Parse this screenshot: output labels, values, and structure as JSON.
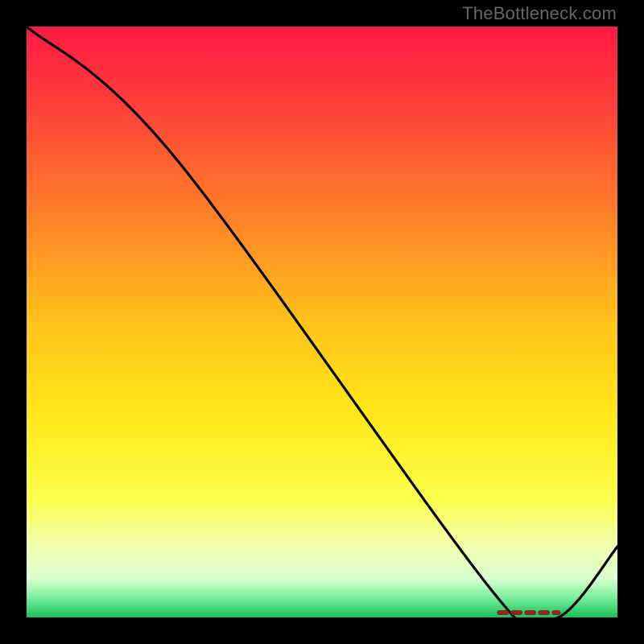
{
  "watermark": "TheBottleneck.com",
  "chart_data": {
    "type": "line",
    "title": "",
    "xlabel": "",
    "ylabel": "",
    "xlim": [
      0,
      100
    ],
    "ylim": [
      0,
      100
    ],
    "x": [
      0,
      25,
      80,
      90,
      100
    ],
    "values": [
      100,
      78,
      3,
      0,
      12
    ],
    "note": "Curve estimated from pixel positions; no axis ticks are rendered in the image.",
    "optimal_band": {
      "x_start": 80,
      "x_end": 90
    },
    "markers": {
      "description": "short dashed maroon stroke near curve minimum",
      "x_start": 80,
      "x_end": 90,
      "y": 0
    },
    "background_gradient_stops": [
      {
        "offset": 0.0,
        "color": "#ff1a44"
      },
      {
        "offset": 0.12,
        "color": "#ff3b3b"
      },
      {
        "offset": 0.3,
        "color": "#ff7a2a"
      },
      {
        "offset": 0.5,
        "color": "#ffc21a"
      },
      {
        "offset": 0.65,
        "color": "#ffe617"
      },
      {
        "offset": 0.8,
        "color": "#fbff4a"
      },
      {
        "offset": 0.88,
        "color": "#f2ffb0"
      },
      {
        "offset": 0.935,
        "color": "#d8ffce"
      },
      {
        "offset": 0.965,
        "color": "#7df0a0"
      },
      {
        "offset": 1.0,
        "color": "#18c05a"
      }
    ]
  }
}
